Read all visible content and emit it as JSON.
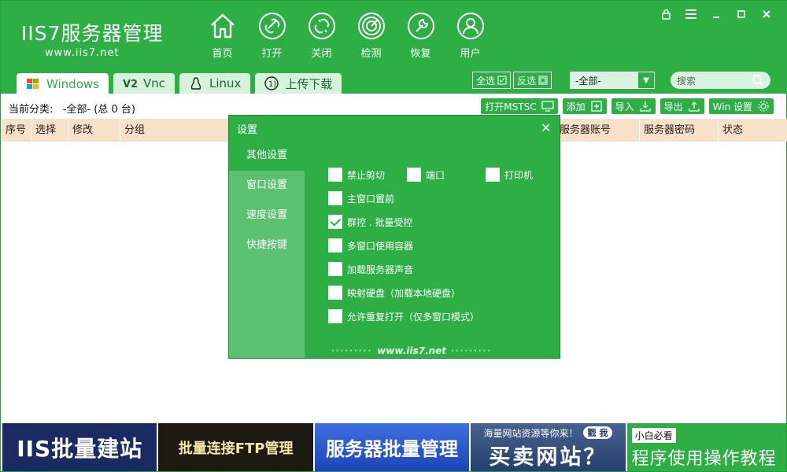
{
  "app": {
    "logo_name": "IIS7服务器管理",
    "logo_url": "www.iis7.net"
  },
  "nav": [
    {
      "label": "首页",
      "icon": "home-icon"
    },
    {
      "label": "打开",
      "icon": "link-icon"
    },
    {
      "label": "关闭",
      "icon": "unlink-icon"
    },
    {
      "label": "检测",
      "icon": "radar-icon"
    },
    {
      "label": "恢复",
      "icon": "wrench-icon"
    },
    {
      "label": "用户",
      "icon": "user-icon"
    }
  ],
  "tabs": [
    {
      "label": "Windows",
      "icon": "windows-icon"
    },
    {
      "label": "Vnc",
      "icon": "vnc-icon"
    },
    {
      "label": "Linux",
      "icon": "linux-icon"
    },
    {
      "label": "上传下载",
      "icon": "upload-icon"
    }
  ],
  "top_tools": {
    "select_all": "全选",
    "invert": "反选",
    "group_select": "-全部-",
    "search_placeholder": "搜索"
  },
  "category": {
    "label": "当前分类:",
    "value": "-全部- (总 0 台)"
  },
  "actions": {
    "open_mstsc": "打开MSTSC",
    "add": "添加",
    "import": "导入",
    "export": "导出",
    "win_settings": "Win 设置"
  },
  "table": {
    "columns": [
      "序号",
      "选择",
      "修改",
      "分组",
      "",
      "服务器账号",
      "服务器密码",
      "状态"
    ]
  },
  "dialog": {
    "title": "设置",
    "side": [
      "其他设置",
      "窗口设置",
      "速度设置",
      "快捷按键"
    ],
    "options": {
      "disable_clipboard": "禁止剪切",
      "port": "端口",
      "printer": "打印机",
      "main_window_top": "主窗口置前",
      "group_control": "群控 . 批量受控",
      "multi_window_container": "多窗口使用容器",
      "load_server_sound": "加载服务器声音",
      "map_disk": "映射硬盘（加载本地硬盘）",
      "allow_reopen": "允许重复打开（仅多窗口模式）"
    },
    "checked": {
      "group_control": true
    },
    "footer": "www.iis7.net"
  },
  "banners": {
    "b1": "IIS批量建站",
    "b2": "批量连接FTP管理",
    "b3": "服务器批量管理",
    "b4_line1": "海量网站资源等你来！",
    "b4_pill": "戳 我",
    "b4_line2": "买卖网站？",
    "b5_line1": "小白必看",
    "b5_line2": "程序使用操作教程"
  },
  "colors": {
    "primary": "#2daf46",
    "header_row": "#f9e0c8",
    "dialog_side": "#5cc171"
  }
}
